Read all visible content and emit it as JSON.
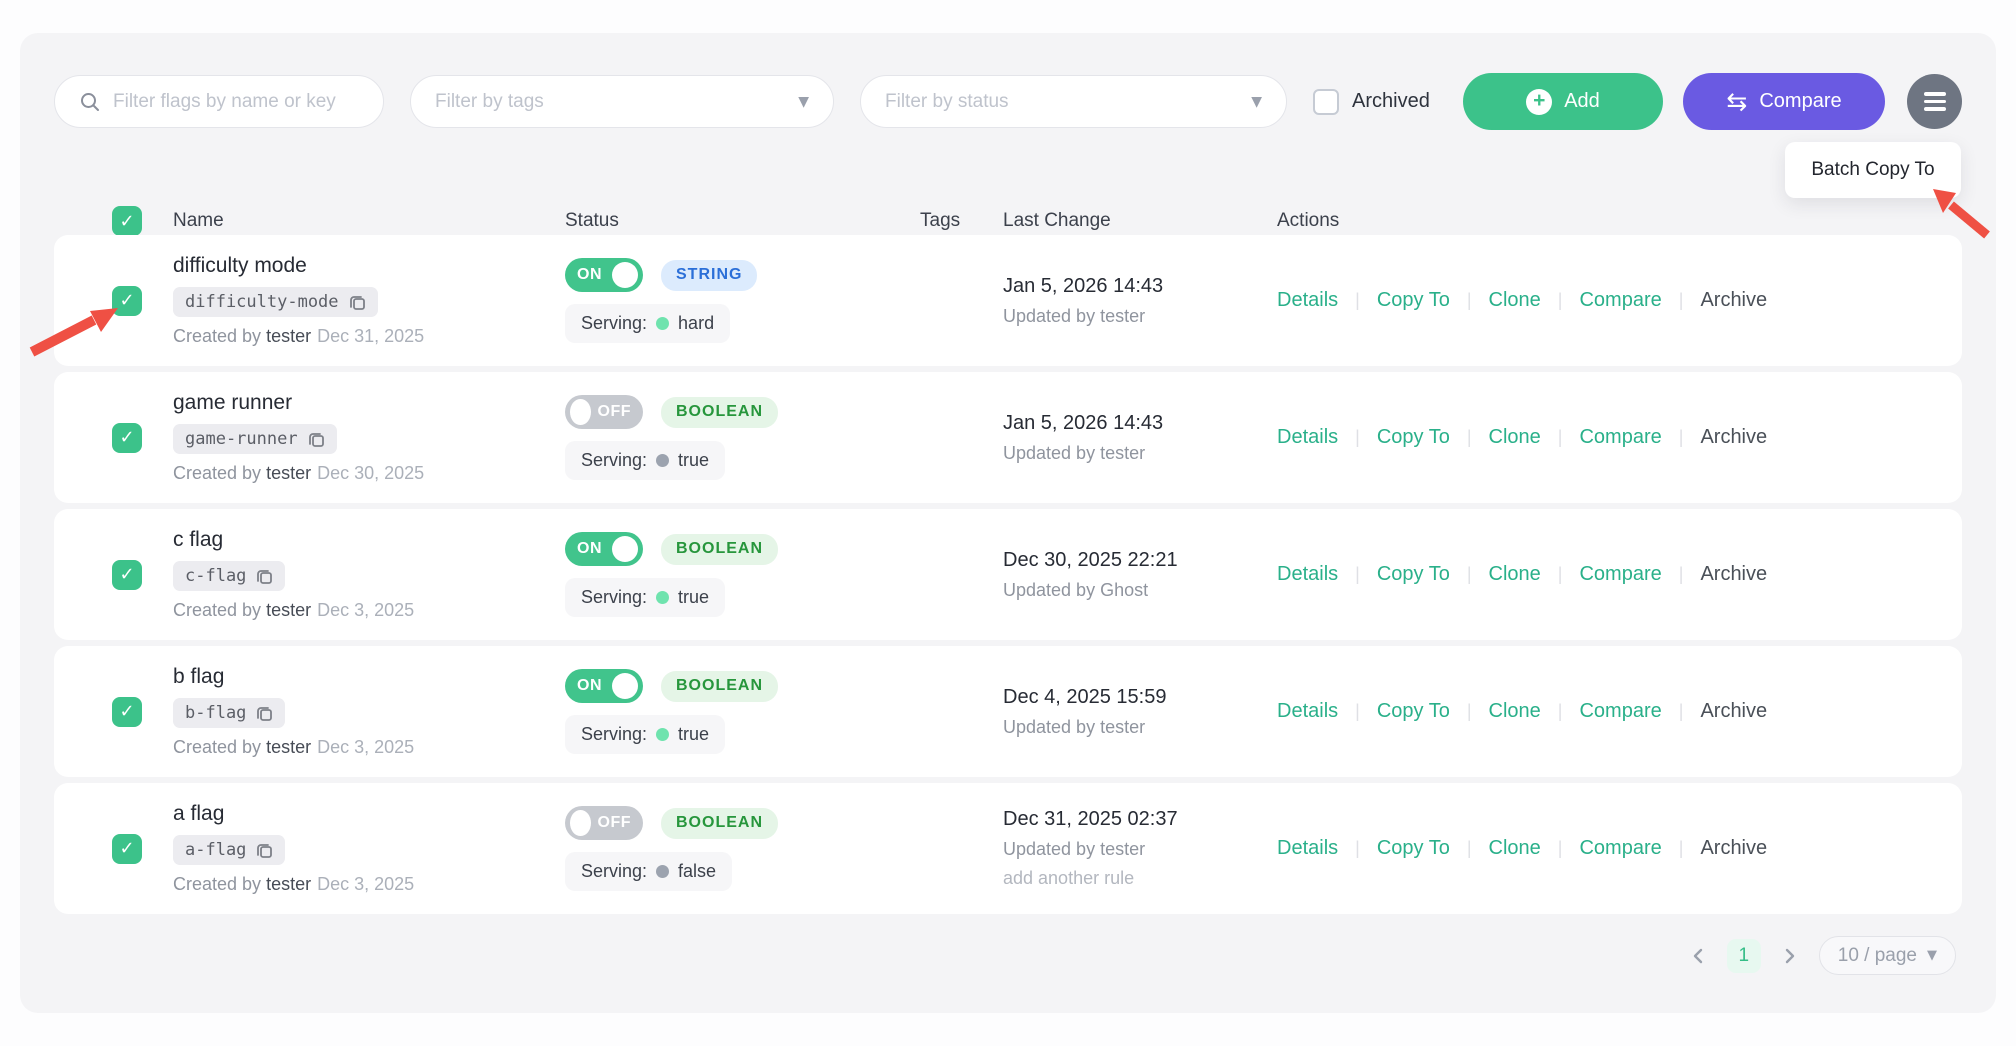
{
  "colors": {
    "accent_green": "#3cc28a",
    "accent_purple": "#6a5ae2",
    "menu_gray": "#6e7582",
    "string_badge_text": "#2b6fd8",
    "boolean_badge_text": "#27963c",
    "action_link": "#2ab08a",
    "annotation_red": "#ef5044",
    "panel_bg": "#f4f4f6"
  },
  "filters": {
    "search_placeholder": "Filter flags by name or key",
    "tags_placeholder": "Filter by tags",
    "status_placeholder": "Filter by status",
    "archived_label": "Archived"
  },
  "toolbar": {
    "add_label": "Add",
    "compare_label": "Compare"
  },
  "menu_popup": {
    "batch_copy_label": "Batch Copy To"
  },
  "table": {
    "headers": [
      "Name",
      "Status",
      "Tags",
      "Last Change",
      "Actions"
    ],
    "created_by_label": "Created by",
    "updated_by_label": "Updated by",
    "serving_label": "Serving:",
    "action_labels": [
      "Details",
      "Copy To",
      "Clone",
      "Compare",
      "Archive"
    ],
    "rows": [
      {
        "name": "difficulty mode",
        "key": "difficulty-mode",
        "creator": "tester",
        "created_date": "Dec 31, 2025",
        "toggle": "ON",
        "type": "STRING",
        "serving": "hard",
        "last_change": "Jan 5, 2026 14:43",
        "updated_by": "tester",
        "note": ""
      },
      {
        "name": "game runner",
        "key": "game-runner",
        "creator": "tester",
        "created_date": "Dec 30, 2025",
        "toggle": "OFF",
        "type": "BOOLEAN",
        "serving": "true",
        "last_change": "Jan 5, 2026 14:43",
        "updated_by": "tester",
        "note": ""
      },
      {
        "name": "c flag",
        "key": "c-flag",
        "creator": "tester",
        "created_date": "Dec 3, 2025",
        "toggle": "ON",
        "type": "BOOLEAN",
        "serving": "true",
        "last_change": "Dec 30, 2025 22:21",
        "updated_by": "Ghost",
        "note": ""
      },
      {
        "name": "b flag",
        "key": "b-flag",
        "creator": "tester",
        "created_date": "Dec 3, 2025",
        "toggle": "ON",
        "type": "BOOLEAN",
        "serving": "true",
        "last_change": "Dec 4, 2025 15:59",
        "updated_by": "tester",
        "note": ""
      },
      {
        "name": "a flag",
        "key": "a-flag",
        "creator": "tester",
        "created_date": "Dec 3, 2025",
        "toggle": "OFF",
        "type": "BOOLEAN",
        "serving": "false",
        "last_change": "Dec 31, 2025 02:37",
        "updated_by": "tester",
        "note": "add another rule"
      }
    ]
  },
  "pagination": {
    "page": "1",
    "page_size": "10 / page"
  }
}
